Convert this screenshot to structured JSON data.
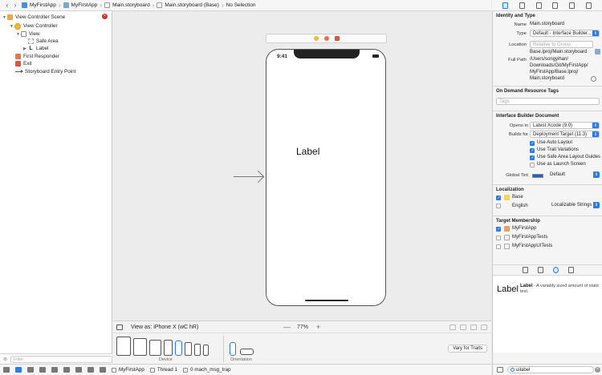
{
  "jumpbar": {
    "crumbs": [
      "MyFirstApp",
      "MyFirstApp",
      "Main.storyboard",
      "Main.storyboard (Base)",
      "No Selection"
    ]
  },
  "navigator": {
    "items": [
      {
        "label": "View Controller Scene"
      },
      {
        "label": "View Controller"
      },
      {
        "label": "View"
      },
      {
        "label": "Safe Area"
      },
      {
        "label": "Label"
      },
      {
        "label": "First Responder"
      },
      {
        "label": "Exit"
      },
      {
        "label": "Storyboard Entry Point"
      }
    ],
    "filter_placeholder": "Filter"
  },
  "canvas": {
    "status_time": "9:41",
    "label_text": "Label"
  },
  "bottom": {
    "view_as": "View as: iPhone X (wC hR)",
    "zoom": "77%",
    "device_caption": "Device",
    "orientation_caption": "Orientation",
    "vary_button": "Vary for Traits"
  },
  "debug": {
    "app": "MyFirstApp",
    "thread": "Thread 1",
    "frame": "0 mach_msg_trap"
  },
  "inspector": {
    "identity_title": "Identity and Type",
    "name_label": "Name",
    "name_value": "Main.storyboard",
    "type_label": "Type",
    "type_value": "Default - Interface Builder...",
    "location_label": "Location",
    "location_value": "Relative to Group",
    "location_path": "Base.lproj/Main.storyboard",
    "fullpath_label": "Full Path",
    "fullpath_lines": [
      "/Users/songyihan/",
      "Downloads/Git/MyFirstApp/",
      "MyFirstApp/Base.lproj/",
      "Main.storyboard"
    ],
    "ondemand_title": "On Demand Resource Tags",
    "tags_placeholder": "Tags",
    "ibdoc_title": "Interface Builder Document",
    "opens_in_label": "Opens in",
    "opens_in_value": "Latest Xcode (9.0)",
    "builds_for_label": "Builds for",
    "builds_for_value": "Deployment Target (11.3)",
    "checks": [
      {
        "label": "Use Auto Layout"
      },
      {
        "label": "Use Trait Variations"
      },
      {
        "label": "Use Safe Area Layout Guides"
      },
      {
        "label": "Use as Launch Screen"
      }
    ],
    "global_tint_label": "Global Tint",
    "global_tint_value": "Default",
    "localization_title": "Localization",
    "loc_base": "Base",
    "loc_english": "English",
    "loc_english_value": "Localizable Strings",
    "target_title": "Target Membership",
    "targets": [
      {
        "label": "MyFirstApp"
      },
      {
        "label": "MyFirstAppTests"
      },
      {
        "label": "MyFirstAppUITests"
      }
    ],
    "library": {
      "big": "Label",
      "title": "Label",
      "desc": "- A variably sized amount of static text."
    },
    "search_value": "uilabel"
  }
}
